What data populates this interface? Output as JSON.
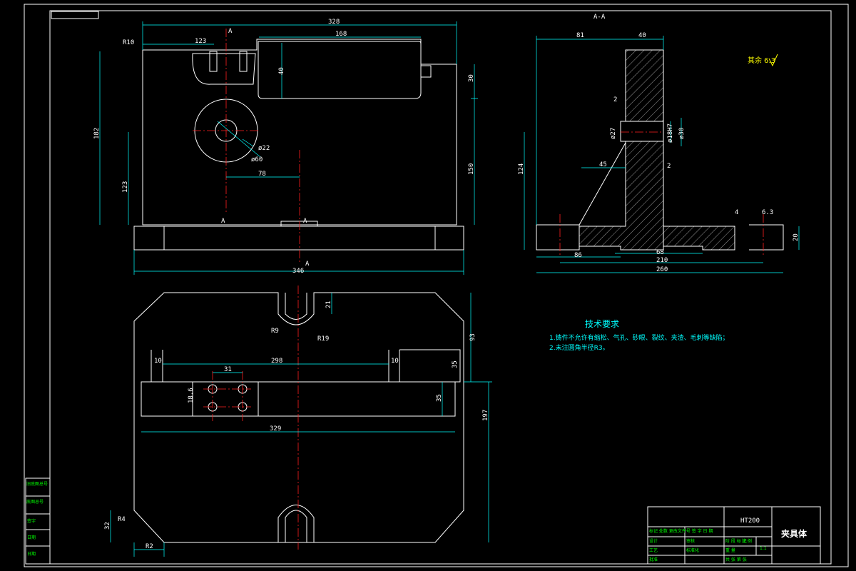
{
  "drawing": {
    "section_label": "A-A",
    "section_mark": "A",
    "roughness_note": "其余 6.3",
    "tech_title": "技术要求",
    "tech_items": [
      "1.铸件不允许有缩松、气孔、砂眼、裂纹、夹渣、毛刺等缺陷；",
      "2.未注圆角半径R3。"
    ],
    "material": "HT200",
    "part_name": "夹具体",
    "scale": "1:1",
    "left_strip": [
      "旧底图总号",
      "底图总号",
      "签字",
      "日期",
      "日期",
      "设计"
    ],
    "title_block_rows": [
      "标记 处数 更改文件号 签 字 日 期",
      "设计",
      "审核",
      "工艺",
      "标准化",
      "批准",
      "阶 段 标 记",
      "重 量",
      "比 例",
      "共 张 第 张"
    ]
  },
  "dims": {
    "front": [
      "328",
      "123",
      "168",
      "R10",
      "40",
      "30",
      "182",
      "123",
      "150",
      "78",
      "ø22",
      "ø60",
      "346"
    ],
    "side": [
      "81",
      "40",
      "2",
      "ø27",
      "ø18H7",
      "ø30",
      "124",
      "45",
      "2",
      "4",
      "6.3",
      "20",
      "86",
      "68",
      "210",
      "260"
    ],
    "top": [
      "21",
      "R9",
      "R19",
      "93",
      "10",
      "298",
      "10",
      "35",
      "31",
      "18.6",
      "35",
      "329",
      "197",
      "R4",
      "32",
      "R2"
    ]
  }
}
